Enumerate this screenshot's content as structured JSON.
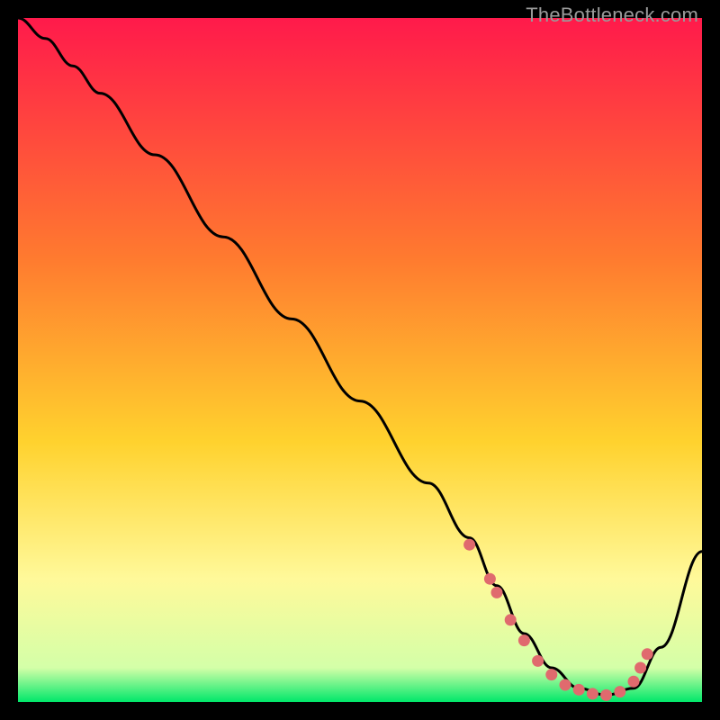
{
  "watermark": "TheBottleneck.com",
  "colors": {
    "gradient_top": "#ff1a4b",
    "gradient_mid1": "#ff7a2f",
    "gradient_mid2": "#ffd22e",
    "gradient_mid3": "#fff99a",
    "gradient_bottom": "#00e76a",
    "line": "#000000",
    "marker": "#e06a6e",
    "bg": "#000000"
  },
  "chart_data": {
    "type": "line",
    "title": "",
    "xlabel": "",
    "ylabel": "",
    "xlim": [
      0,
      100
    ],
    "ylim": [
      0,
      100
    ],
    "series": [
      {
        "name": "curve",
        "x": [
          0,
          4,
          8,
          12,
          20,
          30,
          40,
          50,
          60,
          66,
          70,
          74,
          78,
          82,
          86,
          90,
          94,
          100
        ],
        "y": [
          100,
          97,
          93,
          89,
          80,
          68,
          56,
          44,
          32,
          24,
          17,
          10,
          5,
          2,
          1,
          2,
          8,
          22
        ]
      }
    ],
    "markers": {
      "name": "optimal-zone",
      "x": [
        66,
        69,
        70,
        72,
        74,
        76,
        78,
        80,
        82,
        84,
        86,
        88,
        90,
        91,
        92
      ],
      "y": [
        23,
        18,
        16,
        12,
        9,
        6,
        4,
        2.5,
        1.8,
        1.2,
        1,
        1.5,
        3,
        5,
        7
      ]
    }
  }
}
